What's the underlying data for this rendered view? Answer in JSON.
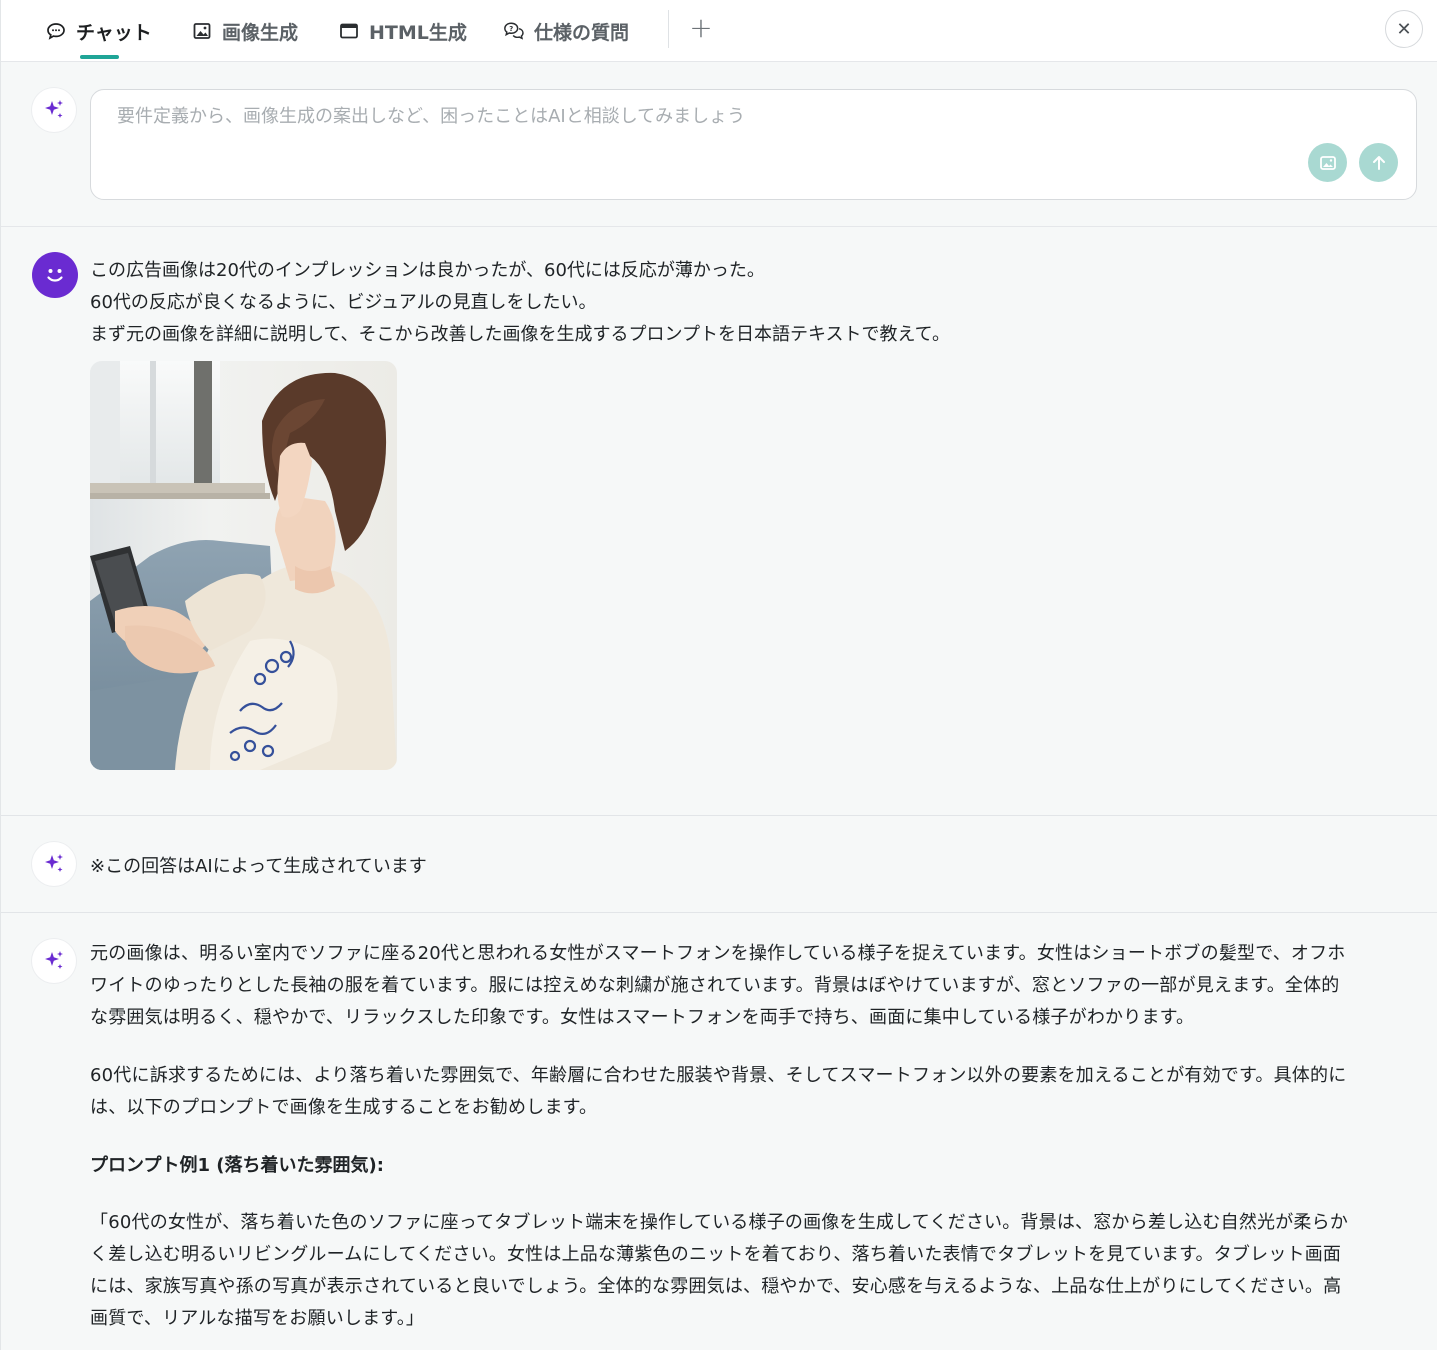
{
  "tabs": [
    {
      "label": "チャット",
      "icon": "chat-bubble-icon",
      "active": true
    },
    {
      "label": "画像生成",
      "icon": "image-icon",
      "active": false
    },
    {
      "label": "HTML生成",
      "icon": "window-icon",
      "active": false
    },
    {
      "label": "仕様の質問",
      "icon": "question-chat-icon",
      "active": false
    }
  ],
  "add_tab_label": "+",
  "close_label": "✕",
  "input": {
    "placeholder": "要件定義から、画像生成の案出しなど、困ったことはAIと相談してみましょう",
    "value": ""
  },
  "user_message": {
    "lines": [
      "この広告画像は20代のインプレッションは良かったが、60代には反応が薄かった。",
      "60代の反応が良くなるように、ビジュアルの見直しをしたい。",
      "まず元の画像を詳細に説明して、そこから改善した画像を生成するプロンプトを日本語テキストで教えて。"
    ]
  },
  "ai_notice": "※この回答はAIによって生成されています",
  "ai_answer": {
    "para1": [
      "元の画像は、明るい室内でソファに座る20代と思われる女性がスマートフォンを操作している様子を捉えています。女性はショートボブの髪型で、オフホ",
      "ワイトのゆったりとした長袖の服を着ています。服には控えめな刺繍が施されています。背景はぼやけていますが、窓とソファの一部が見えます。全体的",
      "な雰囲気は明るく、穏やかで、リラックスした印象です。女性はスマートフォンを両手で持ち、画面に集中している様子がわかります。"
    ],
    "para2": [
      "60代に訴求するためには、より落ち着いた雰囲気で、年齢層に合わせた服装や背景、そしてスマートフォン以外の要素を加えることが有効です。具体的に",
      "は、以下のプロンプトで画像を生成することをお勧めします。"
    ],
    "heading": "プロンプト例1 (落ち着いた雰囲気):",
    "para3": [
      "「60代の女性が、落ち着いた色のソファに座ってタブレット端末を操作している様子の画像を生成してください。背景は、窓から差し込む自然光が柔らか",
      "く差し込む明るいリビングルームにしてください。女性は上品な薄紫色のニットを着ており、落ち着いた表情でタブレットを見ています。タブレット画面",
      "には、家族写真や孫の写真が表示されていると良いでしょう。全体的な雰囲気は、穏やかで、安心感を与えるような、上品な仕上がりにしてください。高",
      "画質で、リアルな描写をお願いします。」"
    ]
  },
  "colors": {
    "accent": "#1fa597",
    "user_avatar": "#6a2bd1",
    "sparkle": "#6a2bd1",
    "button_disabled": "#a9d9d2"
  }
}
